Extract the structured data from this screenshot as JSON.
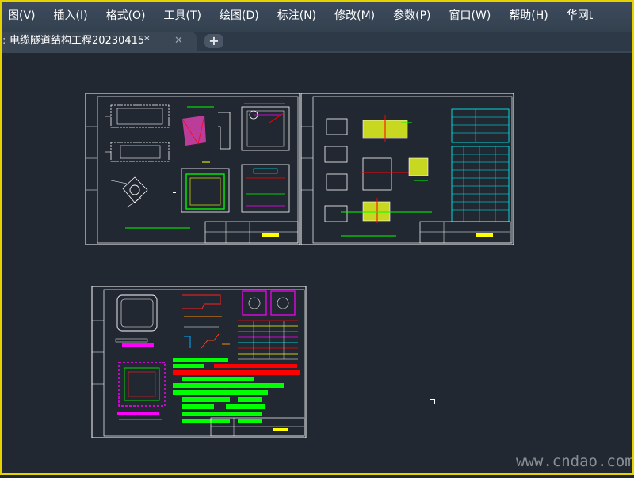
{
  "menu": [
    "图(V)",
    "插入(I)",
    "格式(O)",
    "工具(T)",
    "绘图(D)",
    "标注(N)",
    "修改(M)",
    "参数(P)",
    "窗口(W)",
    "帮助(H)",
    "华网t"
  ],
  "tab": {
    "title": "电缆隧道结构工程20230415*",
    "close_symbol": "✕",
    "new_tab_symbol": "+"
  },
  "watermark": "www.cndao.com",
  "colors": {
    "frame": "#e6d200",
    "background": "#212831",
    "menubar": "#3d4b5e",
    "drawing_border": "#ffffff",
    "magenta": "#ff00ff",
    "green": "#00ff00",
    "red": "#ff0000",
    "cyan": "#00ffff",
    "yellow": "#ffff00"
  }
}
